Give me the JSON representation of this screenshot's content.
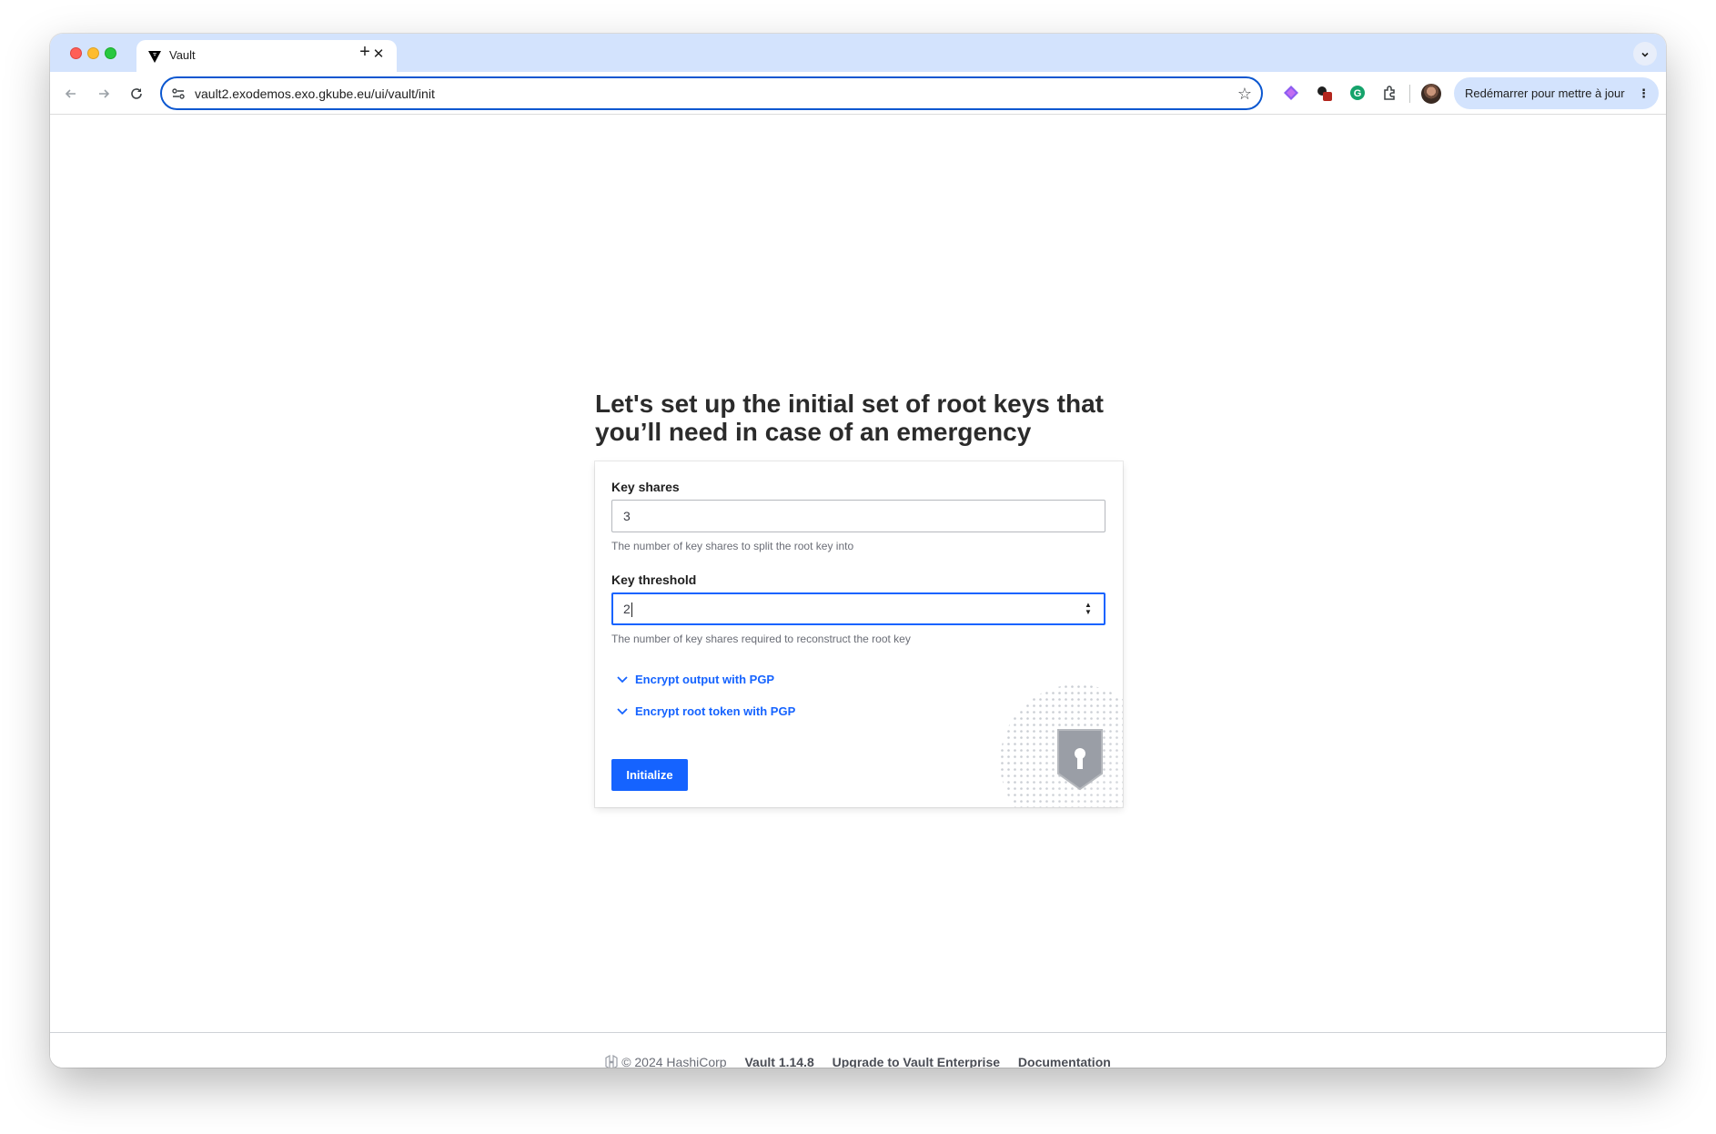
{
  "browser": {
    "tab_title": "Vault",
    "url": "vault2.exodemos.exo.gkube.eu/ui/vault/init",
    "update_button": "Redémarrer pour mettre à jour",
    "new_tab_symbol": "+",
    "close_symbol": "✕"
  },
  "init": {
    "headline_line1": "Let's set up the initial set of root keys that",
    "headline_line2": "you’ll need in case of an emergency",
    "key_shares": {
      "label": "Key shares",
      "value": "3",
      "help": "The number of key shares to split the root key into"
    },
    "key_threshold": {
      "label": "Key threshold",
      "value": "2",
      "help": "The number of key shares required to reconstruct the root key"
    },
    "toggles": [
      {
        "label": "Encrypt output with PGP"
      },
      {
        "label": "Encrypt root token with PGP"
      }
    ],
    "submit_label": "Initialize"
  },
  "footer": {
    "copyright": "© 2024 HashiCorp",
    "version": "Vault 1.14.8",
    "upgrade_link": "Upgrade to Vault Enterprise",
    "docs_link": "Documentation"
  },
  "colors": {
    "accent": "#1563ff",
    "tabstrip": "#d3e3fd",
    "omnibox_focus": "#0b57d0"
  }
}
